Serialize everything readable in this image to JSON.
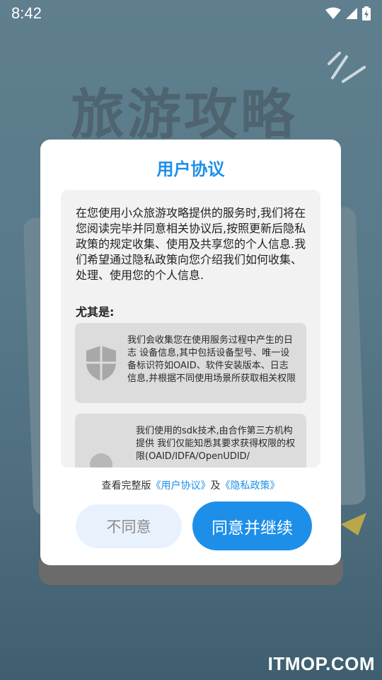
{
  "status_bar": {
    "time": "8:42",
    "icons": [
      "wifi-icon",
      "signal-icon",
      "battery-icon"
    ]
  },
  "background": {
    "title": "旅游攻略"
  },
  "dialog": {
    "title": "用户协议",
    "intro": "在您使用小众旅游攻略提供的服务时,我们将在您阅读完毕并同意相关协议后,按照更新后隐私政策的规定收集、使用及共享您的个人信息.我们希望通过隐私政策向您介绍我们如何收集、处理、使用您的个人信息.",
    "sub_heading": "尤其是:",
    "cards": [
      {
        "icon": "shield-icon",
        "text": "我们会收集您在使用服务过程中产生的日志 设备信息,其中包括设备型号、唯一设备标识符如OAID、软件安装版本、日志信息,并根据不同使用场景所获取相关权限"
      },
      {
        "icon": "sdk-icon",
        "text": "我们使用的sdk技术,由合作第三方机构提供 我们仅能知悉其要求获得权限的权限(OAID/IDFA/OpenUDID/"
      }
    ],
    "links": {
      "prefix": "查看完整版",
      "user_agreement": "《用户协议》",
      "and": "及",
      "privacy_policy": "《隐私政策》"
    },
    "buttons": {
      "disagree": "不同意",
      "agree": "同意并继续"
    }
  },
  "watermark": "ITMOP.COM",
  "colors": {
    "accent": "#1e8fe8",
    "dialog_bg": "#ffffff",
    "content_bg": "#f2f2f2",
    "card_bg": "#dcdcdc",
    "disagree_bg": "#e8f2fd"
  }
}
